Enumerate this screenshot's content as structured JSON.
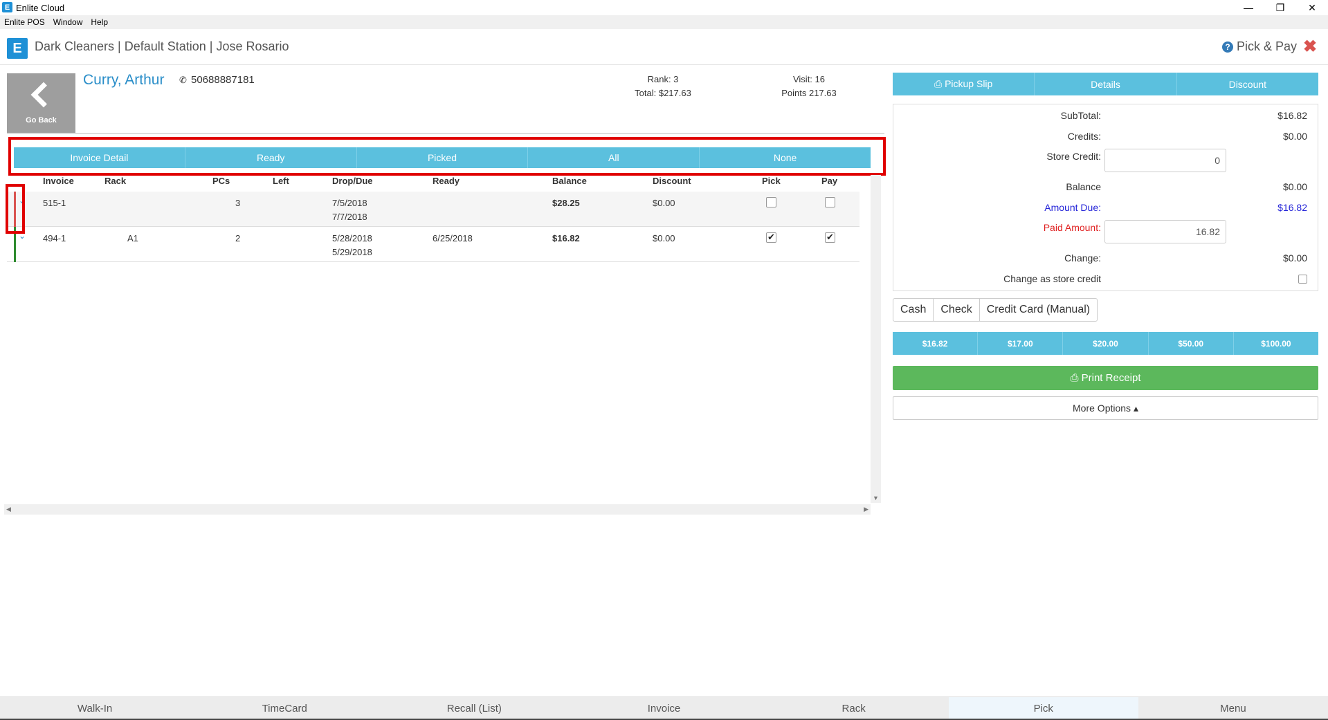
{
  "window": {
    "logo_letter": "E",
    "title": "Enlite Cloud",
    "controls": {
      "minimize": "—",
      "maximize": "❐",
      "close": "✕"
    }
  },
  "menu": [
    "Enlite POS",
    "Window",
    "Help"
  ],
  "header": {
    "logo_letter": "E",
    "title": "Dark Cleaners | Default Station | Jose Rosario",
    "help_icon": "?",
    "page": "Pick & Pay",
    "close_icon": "✖"
  },
  "customer": {
    "go_back": "Go Back",
    "name": "Curry, Arthur",
    "phone_icon": "✆",
    "phone": "50688887181",
    "rank": "Rank: 3",
    "total": "Total: $217.63",
    "visit": "Visit: 16",
    "points": "Points 217.63"
  },
  "filters": [
    "Invoice Detail",
    "Ready",
    "Picked",
    "All",
    "None"
  ],
  "table": {
    "headers": {
      "invoice": "Invoice",
      "rack": "Rack",
      "pcs": "PCs",
      "left": "Left",
      "drop_due": "Drop/Due",
      "ready": "Ready",
      "balance": "Balance",
      "discount": "Discount",
      "pick": "Pick",
      "pay": "Pay"
    },
    "rows": [
      {
        "expander": "⌄",
        "invoice": "515-1",
        "rack": "",
        "pcs": "3",
        "left": "",
        "drop": "7/5/2018",
        "due": "7/7/2018",
        "ready": "",
        "balance": "$28.25",
        "discount": "$0.00",
        "pick": false,
        "pay": false,
        "status_color": "#d9534f"
      },
      {
        "expander": "⌄",
        "invoice": "494-1",
        "rack": "A1",
        "pcs": "2",
        "left": "",
        "drop": "5/28/2018",
        "due": "5/29/2018",
        "ready": "6/25/2018",
        "balance": "$16.82",
        "discount": "$0.00",
        "pick": true,
        "pay": true,
        "status_color": "#2e8b2e"
      }
    ]
  },
  "scroll_arrows": {
    "down": "▼",
    "left": "◀",
    "right": "▶"
  },
  "actions": [
    "⎙ Pickup Slip",
    "Details",
    "Discount"
  ],
  "summary": {
    "subtotal_label": "SubTotal:",
    "subtotal": "$16.82",
    "credits_label": "Credits:",
    "credits": "$0.00",
    "store_credit_label": "Store Credit:",
    "store_credit": "0",
    "balance_label": "Balance",
    "balance": "$0.00",
    "amount_due_label": "Amount Due:",
    "amount_due": "$16.82",
    "paid_label": "Paid Amount:",
    "paid": "16.82",
    "change_label": "Change:",
    "change": "$0.00",
    "change_credit_label": "Change as store credit"
  },
  "payment_methods": [
    "Cash",
    "Check",
    "Credit Card (Manual)"
  ],
  "quick_amounts": [
    "$16.82",
    "$17.00",
    "$20.00",
    "$50.00",
    "$100.00"
  ],
  "print_receipt": "⎙ Print Receipt",
  "more_options": "More Options ▴",
  "nav": [
    "Walk-In",
    "TimeCard",
    "Recall (List)",
    "Invoice",
    "Rack",
    "Pick",
    "Menu"
  ],
  "active_nav": "Pick"
}
